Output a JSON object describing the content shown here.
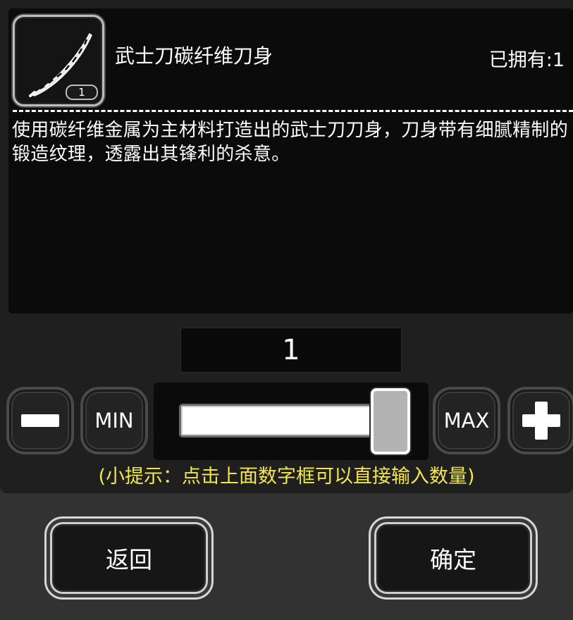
{
  "item": {
    "name": "武士刀碳纤维刀身",
    "icon": "katana-blade-icon",
    "count_badge": "1",
    "owned_label": "已拥有:1",
    "description": "使用碳纤维金属为主材料打造出的武士刀刀身，刀身带有细腻精制的锻造纹理，透露出其锋利的杀意。"
  },
  "quantity": {
    "value": "1",
    "min_label": "MIN",
    "max_label": "MAX",
    "slider_fraction": 1.0
  },
  "hint": "(小提示：点击上面数字框可以直接输入数量)",
  "buttons": {
    "back": "返回",
    "confirm": "确定"
  },
  "colors": {
    "hint_text": "#f2e64a",
    "panel": "#1f1f1f",
    "info_box": "#0b0b0c"
  }
}
